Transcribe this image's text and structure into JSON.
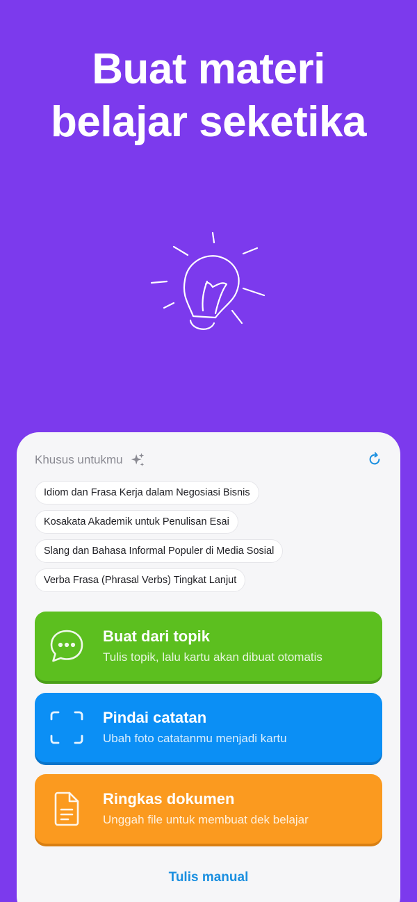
{
  "hero": {
    "title_line1": "Buat materi",
    "title_line2": "belajar seketika"
  },
  "icons": {
    "hero": "lightbulb-icon",
    "sparkle": "sparkle-icon",
    "refresh": "refresh-icon",
    "chat": "chat-bubble-icon",
    "scan": "scan-frame-icon",
    "document": "document-icon"
  },
  "suggestions": {
    "header": "Khusus untukmu",
    "chips": [
      "Idiom dan Frasa Kerja dalam Negosiasi Bisnis",
      "Kosakata Akademik untuk Penulisan Esai",
      "Slang dan Bahasa Informal Populer di Media Sosial",
      "Verba Frasa (Phrasal Verbs) Tingkat Lanjut"
    ]
  },
  "actions": [
    {
      "title": "Buat dari topik",
      "subtitle": "Tulis topik, lalu kartu akan dibuat otomatis",
      "color": "#5cbf1f"
    },
    {
      "title": "Pindai catatan",
      "subtitle": "Ubah foto catatanmu menjadi kartu",
      "color": "#0b8ff5"
    },
    {
      "title": "Ringkas dokumen",
      "subtitle": "Unggah file untuk membuat dek belajar",
      "color": "#fb9a1f"
    }
  ],
  "footer": {
    "manual_label": "Tulis manual"
  },
  "colors": {
    "background": "#7c3aed",
    "card": "#f6f6f8",
    "link": "#1a8fe0"
  }
}
